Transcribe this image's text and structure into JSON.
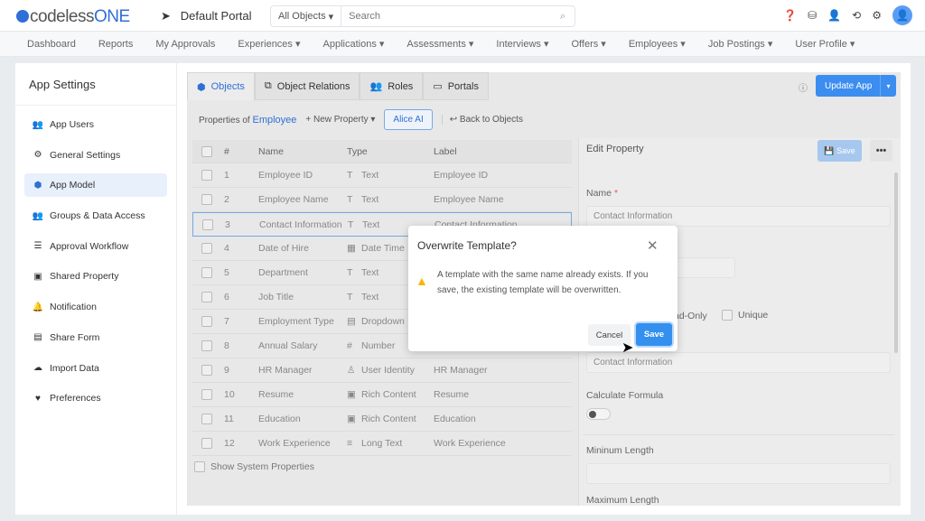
{
  "header": {
    "logo": "codelessONE",
    "portal": "Default Portal",
    "search_scope": "All Objects",
    "search_placeholder": "Search"
  },
  "nav": [
    "Dashboard",
    "Reports",
    "My Approvals",
    "Experiences ▾",
    "Applications ▾",
    "Assessments ▾",
    "Interviews ▾",
    "Offers ▾",
    "Employees ▾",
    "Job Postings ▾",
    "User Profile ▾"
  ],
  "sidebar": {
    "title": "App Settings",
    "items": [
      {
        "label": "App Users",
        "icon": "👥"
      },
      {
        "label": "General Settings",
        "icon": "⚙"
      },
      {
        "label": "App Model",
        "icon": "⬢",
        "active": true
      },
      {
        "label": "Groups & Data Access",
        "icon": "👥"
      },
      {
        "label": "Approval Workflow",
        "icon": "☰"
      },
      {
        "label": "Shared Property",
        "icon": "▣"
      },
      {
        "label": "Notification",
        "icon": "🔔"
      },
      {
        "label": "Share Form",
        "icon": "▤"
      },
      {
        "label": "Import Data",
        "icon": "☁"
      },
      {
        "label": "Preferences",
        "icon": "♥"
      }
    ]
  },
  "tabs": [
    {
      "label": "Objects",
      "icon": "⬢"
    },
    {
      "label": "Object Relations",
      "icon": "⧉"
    },
    {
      "label": "Roles",
      "icon": "👥"
    },
    {
      "label": "Portals",
      "icon": "▭"
    }
  ],
  "update_app": "Update App",
  "toolbar": {
    "properties_of": "Properties of",
    "object": "Employee",
    "new_property": "+ New Property ▾",
    "alice": "Alice AI",
    "back": "↩ Back to Objects"
  },
  "table": {
    "headers": [
      "#",
      "Name",
      "Type",
      "Label"
    ],
    "rows": [
      [
        "1",
        "Employee ID",
        "T",
        "Text",
        "Employee ID"
      ],
      [
        "2",
        "Employee Name",
        "T",
        "Text",
        "Employee Name"
      ],
      [
        "3",
        "Contact Information",
        "T",
        "Text",
        "Contact Information"
      ],
      [
        "4",
        "Date of Hire",
        "▦",
        "Date Time",
        ""
      ],
      [
        "5",
        "Department",
        "T",
        "Text",
        ""
      ],
      [
        "6",
        "Job Title",
        "T",
        "Text",
        ""
      ],
      [
        "7",
        "Employment Type",
        "▤",
        "Dropdown",
        ""
      ],
      [
        "8",
        "Annual Salary",
        "#",
        "Number",
        ""
      ],
      [
        "9",
        "HR Manager",
        "♙",
        "User Identity",
        "HR Manager"
      ],
      [
        "10",
        "Resume",
        "▣",
        "Rich Content",
        "Resume"
      ],
      [
        "11",
        "Education",
        "▣",
        "Rich Content",
        "Education"
      ],
      [
        "12",
        "Work Experience",
        "≡",
        "Long Text",
        "Work Experience"
      ]
    ]
  },
  "show_system": "Show System Properties",
  "edit": {
    "title": "Edit Property",
    "save": "💾 Save",
    "more": "•••",
    "name_label": "Name",
    "required": "*",
    "name_value": "Contact Information",
    "readonly": "ad-Only",
    "unique": "Unique",
    "label_value": "Contact Information",
    "calc": "Calculate Formula",
    "min": "Mininum Length",
    "max": "Maximum Length"
  },
  "dialog": {
    "title": "Overwrite Template?",
    "message": "A template with the same name already exists. If you save, the existing template will be overwritten.",
    "cancel": "Cancel",
    "save": "Save"
  }
}
